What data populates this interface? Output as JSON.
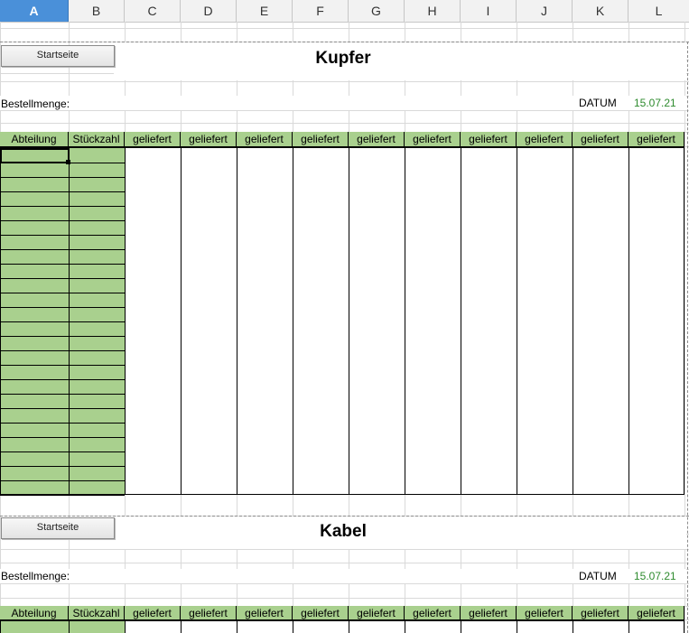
{
  "column_headers": [
    "A",
    "B",
    "C",
    "D",
    "E",
    "F",
    "G",
    "H",
    "I",
    "J",
    "K",
    "L"
  ],
  "selected_column": "A",
  "section1": {
    "button_label": "Startseite",
    "title": "Kupfer",
    "bestellmenge_label": "Bestellmenge:",
    "datum_label": "DATUM",
    "datum_value": "15.07.21",
    "table_headers": [
      "Abteilung",
      "Stückzahl",
      "geliefert",
      "geliefert",
      "geliefert",
      "geliefert",
      "geliefert",
      "geliefert",
      "geliefert",
      "geliefert",
      "geliefert",
      "geliefert"
    ]
  },
  "section2": {
    "button_label": "Startseite",
    "title": "Kabel",
    "bestellmenge_label": "Bestellmenge:",
    "datum_label": "DATUM",
    "datum_value": "15.07.21",
    "table_headers": [
      "Abteilung",
      "Stückzahl",
      "geliefert",
      "geliefert",
      "geliefert",
      "geliefert",
      "geliefert",
      "geliefert",
      "geliefert",
      "geliefert",
      "geliefert",
      "geliefert"
    ]
  },
  "colors": {
    "header_green": "#a9d08e",
    "date_green": "#2e8b2e",
    "selection_blue": "#4a90d9"
  }
}
